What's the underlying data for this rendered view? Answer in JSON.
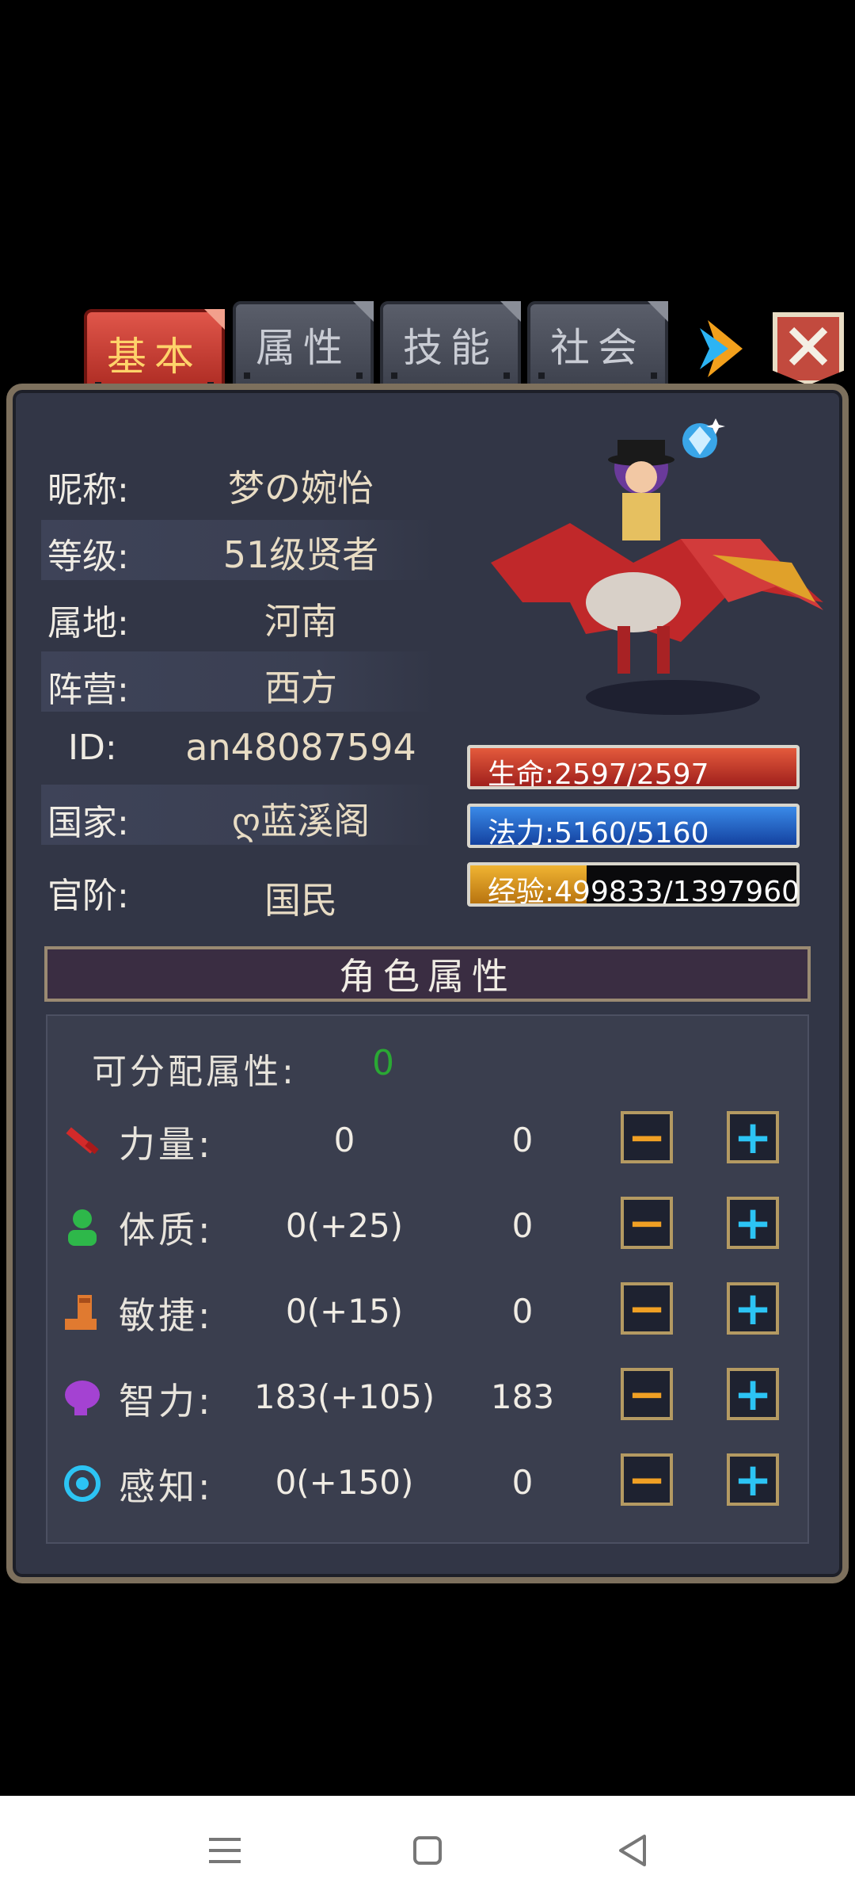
{
  "tabs": [
    "基本",
    "属性",
    "技能",
    "社会"
  ],
  "profile": [
    {
      "label": "昵称:",
      "value": "梦の婉怡"
    },
    {
      "label": "等级:",
      "value": "51级贤者"
    },
    {
      "label": "属地:",
      "value": "河南"
    },
    {
      "label": "阵营:",
      "value": "西方"
    },
    {
      "label": "ID:",
      "value": "an48087594"
    },
    {
      "label": "国家:",
      "value": "ღ蓝溪阁"
    },
    {
      "label": "官阶:",
      "value": "国民"
    }
  ],
  "bars": {
    "hp": {
      "text": "生命:2597/2597",
      "fraction": 1.0
    },
    "mp": {
      "text": "法力:5160/5160",
      "fraction": 1.0
    },
    "exp": {
      "text": "经验:499833/1397960",
      "fraction": 0.358
    }
  },
  "attributes": {
    "section_title": "角色属性",
    "allocatable_label": "可分配属性:",
    "allocatable_value": "0",
    "minus_symbol": "−",
    "plus_symbol": "+",
    "rows": [
      {
        "name": "力量:",
        "base": "0",
        "total": "0",
        "icon": "sword-icon"
      },
      {
        "name": "体质:",
        "base": "0(+25)",
        "total": "0",
        "icon": "person-icon"
      },
      {
        "name": "敏捷:",
        "base": "0(+15)",
        "total": "0",
        "icon": "boot-icon"
      },
      {
        "name": "智力:",
        "base": "183(+105)",
        "total": "183",
        "icon": "brain-icon"
      },
      {
        "name": "感知:",
        "base": "0(+150)",
        "total": "0",
        "icon": "target-icon"
      }
    ]
  },
  "colors": {
    "hp": "#c8302a",
    "mp": "#1e63c8",
    "exp": "#d89a22",
    "allocatable": "#2aa834"
  }
}
